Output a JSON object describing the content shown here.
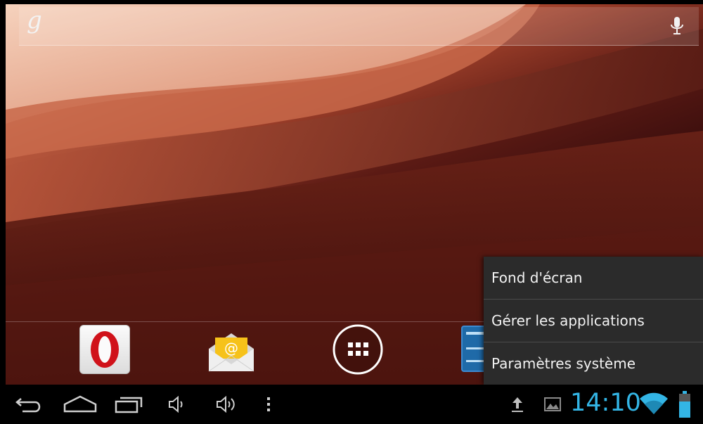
{
  "search": {
    "google_glyph": "g",
    "left_icon": "google-g-icon",
    "right_icon": "microphone-icon"
  },
  "hotseat": {
    "apps": [
      {
        "name": "Opera",
        "icon": "opera-icon",
        "glyph": "O"
      },
      {
        "name": "Email",
        "icon": "email-icon",
        "glyph": "@"
      },
      {
        "name": "All apps",
        "icon": "all-apps-icon"
      },
      {
        "name": "Settings",
        "icon": "settings-icon"
      }
    ]
  },
  "menu": {
    "items": [
      {
        "label": "Fond d'écran"
      },
      {
        "label": "Gérer les applications"
      },
      {
        "label": "Paramètres système"
      }
    ]
  },
  "navbar": {
    "buttons": [
      "back-icon",
      "home-icon",
      "recent-apps-icon",
      "volume-down-icon",
      "volume-up-icon",
      "menu-dots-icon"
    ]
  },
  "status": {
    "time": "14:10",
    "icons": [
      "upload-icon",
      "image-icon",
      "wifi-icon",
      "battery-icon"
    ],
    "accent_color": "#33b5e5"
  }
}
